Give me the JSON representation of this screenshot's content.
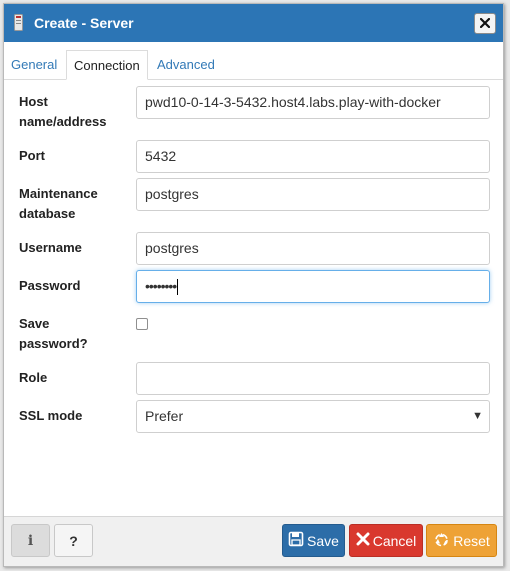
{
  "dialog": {
    "title": "Create - Server",
    "close_label": "×"
  },
  "tabs": [
    {
      "label": "General"
    },
    {
      "label": "Connection"
    },
    {
      "label": "Advanced"
    }
  ],
  "active_tab": "Connection",
  "form": {
    "host": {
      "label": "Host name/address",
      "value": "pwd10-0-14-3-5432.host4.labs.play-with-docker"
    },
    "port": {
      "label": "Port",
      "value": "5432"
    },
    "maintenance_db": {
      "label": "Maintenance database",
      "value": "postgres"
    },
    "username": {
      "label": "Username",
      "value": "postgres"
    },
    "password": {
      "label": "Password",
      "value": "••••••••"
    },
    "save_password": {
      "label": "Save password?",
      "checked": false
    },
    "role": {
      "label": "Role",
      "value": ""
    },
    "ssl_mode": {
      "label": "SSL mode",
      "value": "Prefer"
    }
  },
  "footer": {
    "info_label": "i",
    "help_label": "?",
    "save_label": "Save",
    "cancel_label": "Cancel",
    "reset_label": "Reset"
  },
  "colors": {
    "titlebar": "#2c75b5",
    "save": "#2c6da8",
    "cancel": "#d9382e",
    "reset": "#eea236"
  },
  "icons": [
    "server-icon",
    "close-icon",
    "floppy-disk-icon",
    "x-icon",
    "recycle-icon"
  ]
}
